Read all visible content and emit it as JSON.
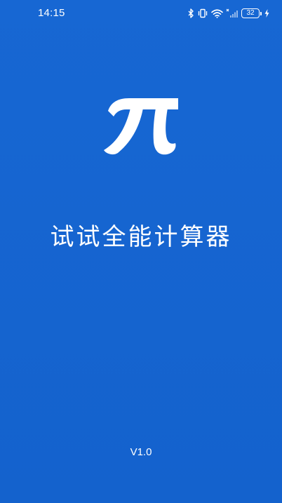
{
  "status_bar": {
    "time": "14:15",
    "battery_level": "32",
    "icons": [
      "bluetooth-icon",
      "vibrate-icon",
      "wifi-icon",
      "signal-icon",
      "battery-icon",
      "charging-icon"
    ]
  },
  "splash": {
    "logo_icon": "pi-icon",
    "app_name": "试试全能计算器",
    "version": "V1.0"
  },
  "colors": {
    "background": "#1565d0",
    "foreground": "#ffffff"
  }
}
